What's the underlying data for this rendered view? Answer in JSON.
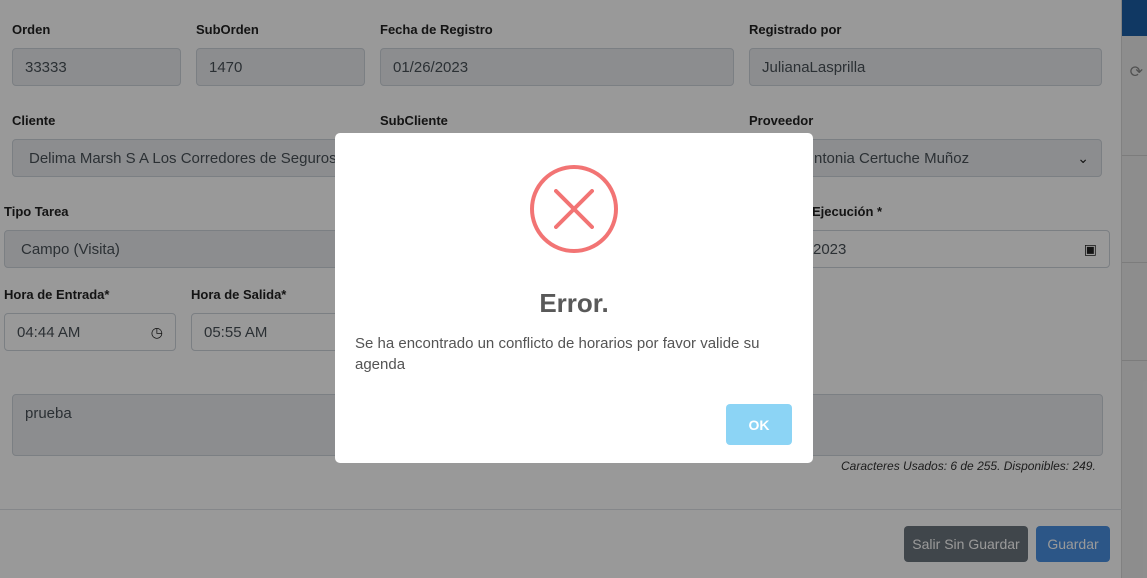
{
  "form": {
    "orden_label": "Orden",
    "orden_value": "33333",
    "suborden_label": "SubOrden",
    "suborden_value": "1470",
    "fecha_label": "Fecha de Registro",
    "fecha_value": "01/26/2023",
    "registrado_label": "Registrado por",
    "registrado_value": "JulianaLasprilla",
    "cliente_label": "Cliente",
    "cliente_value": "Delima Marsh S A Los Corredores de Seguros",
    "subcliente_label": "SubCliente",
    "proveedor_label": "Proveedor",
    "proveedor_value": "ntonia Certuche Muñoz",
    "tipo_label": "Tipo Tarea",
    "tipo_value": "Campo (Visita)",
    "ejecucion_label": "Ejecución *",
    "ejecucion_value": "2023",
    "hora_entrada_label": "Hora de Entrada*",
    "hora_entrada_value": "04:44 AM",
    "hora_salida_label": "Hora de Salida*",
    "hora_salida_value": "05:55 AM",
    "descripcion_value": "prueba",
    "chars_text": "Caracteres Usados: 6 de 255. Disponibles: 249.",
    "salir_label": "Salir Sin Guardar",
    "guardar_label": "Guardar"
  },
  "alert": {
    "icon": "error-x-icon",
    "title": "Error.",
    "message": "Se ha encontrado un conflicto de horarios por favor valide su agenda",
    "ok_label": "OK"
  },
  "colors": {
    "error_red": "#f27474",
    "ok_button": "#8cd4f5",
    "guardar_button": "#4a90e2",
    "salir_button": "#6c757d",
    "topbar": "#1b5ea6"
  }
}
